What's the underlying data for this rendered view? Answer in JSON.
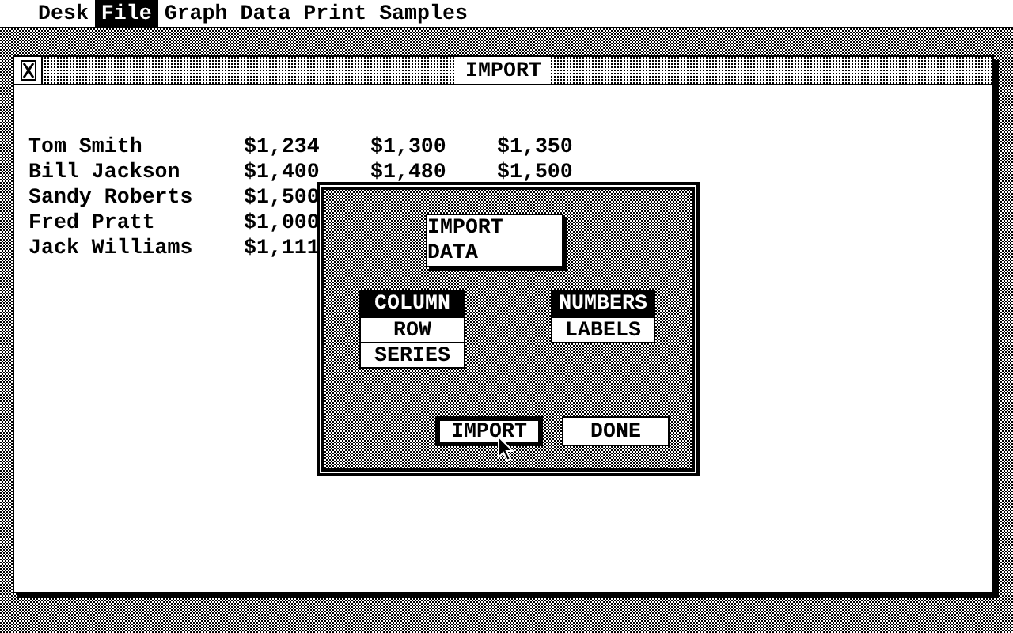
{
  "menu": [
    {
      "label": "Desk",
      "selected": false
    },
    {
      "label": "File",
      "selected": true
    },
    {
      "label": "Graph",
      "selected": false
    },
    {
      "label": "Data",
      "selected": false
    },
    {
      "label": "Print",
      "selected": false
    },
    {
      "label": "Samples",
      "selected": false
    }
  ],
  "window": {
    "title": "IMPORT"
  },
  "rows": [
    {
      "name": "Tom Smith",
      "values": [
        "$1,234",
        "$1,300",
        "$1,350"
      ]
    },
    {
      "name": "Bill Jackson",
      "values": [
        "$1,400",
        "$1,480",
        "$1,500"
      ]
    },
    {
      "name": "Sandy Roberts",
      "values": [
        "$1,500"
      ]
    },
    {
      "name": "Fred Pratt",
      "values": [
        "$1,000"
      ]
    },
    {
      "name": "Jack Williams",
      "values": [
        "$1,111"
      ]
    }
  ],
  "dialog": {
    "title": "IMPORT DATA",
    "range_options": [
      {
        "label": "COLUMN",
        "selected": true
      },
      {
        "label": "ROW",
        "selected": false
      },
      {
        "label": "SERIES",
        "selected": false
      }
    ],
    "type_options": [
      {
        "label": "NUMBERS",
        "selected": true
      },
      {
        "label": "LABELS",
        "selected": false
      }
    ],
    "buttons": [
      {
        "label": "IMPORT",
        "default": true
      },
      {
        "label": "DONE",
        "default": false
      }
    ]
  }
}
